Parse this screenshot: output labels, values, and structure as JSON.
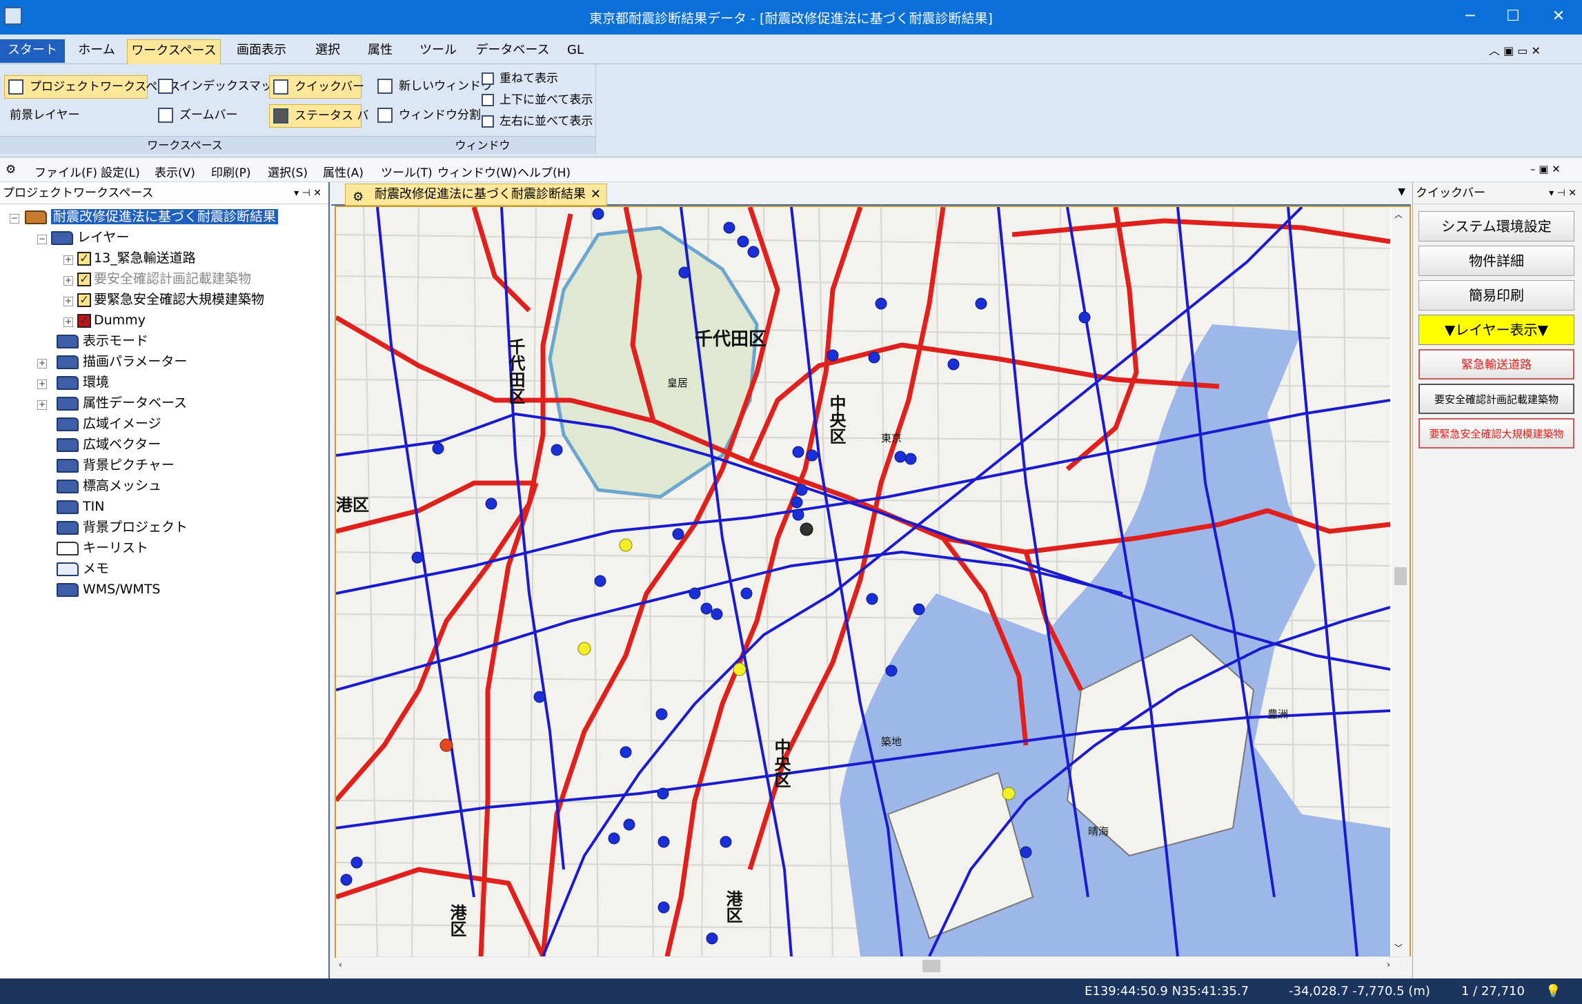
{
  "title": "東京都耐震診断結果データ - [耐震改修促進法に基づく耐震診断結果]",
  "ribbon_tabs": [
    "スタート",
    "ホーム",
    "ワークスペース",
    "画面表示",
    "選択",
    "属性",
    "ツール",
    "データベース",
    "GL"
  ],
  "ribbon": {
    "workspace": {
      "project_ws": "プロジェクトワークスペース",
      "foreground_layer": "前景レイヤー",
      "index_map": "インデックスマップ",
      "zoom_bar": "ズームバー",
      "quick_bar": "クイックバー",
      "status_bar": "ステータス バー",
      "group_label": "ワークスペース"
    },
    "window": {
      "new_window": "新しいウィンドウ",
      "split": "ウィンドウ分割",
      "cascade": "重ねて表示",
      "tile_horizontal": "上下に並べて表示",
      "tile_vertical": "左右に並べて表示",
      "group_label": "ウィンドウ"
    }
  },
  "menu": [
    "ファイル(F)",
    "設定(L)",
    "表示(V)",
    "印刷(P)",
    "選択(S)",
    "属性(A)",
    "ツール(T)",
    "ウィンドウ(W)",
    "ヘルプ(H)"
  ],
  "left_pane": {
    "header": "プロジェクトワークスペース",
    "root": "耐震改修促進法に基づく耐震診断結果",
    "layer": "レイヤー",
    "layers": [
      "13_緊急輸送道路",
      "要安全確認計画記載建築物",
      "要緊急安全確認大規模建築物",
      "Dummy"
    ],
    "folders": [
      "表示モード",
      "描画パラメーター",
      "環境",
      "属性データベース",
      "広域イメージ",
      "広域ベクター",
      "背景ピクチャー",
      "標高メッシュ",
      "TIN",
      "背景プロジェクト",
      "キーリスト",
      "メモ",
      "WMS/WMTS"
    ]
  },
  "map_tab": "耐震改修促進法に基づく耐震診断結果",
  "map_labels": {
    "chiyoda": "千代田区",
    "chiyoda_v": "千代田区",
    "chuo1": "中央区",
    "chuo2": "中央区",
    "minato1": "港区",
    "minato2": "港区",
    "minato3": "港区",
    "kokyo": "皇居",
    "tokyo": "東京",
    "tsukiji": "築地",
    "harumi": "晴海",
    "toyosu": "豊洲"
  },
  "quick_pane": {
    "header": "クイックバー",
    "buttons": [
      "システム環境設定",
      "物件詳細",
      "簡易印刷",
      "▼レイヤー表示▼",
      "緊急輸送道路",
      "要安全確認計画記載建築物",
      "要緊急安全確認大規模建築物"
    ]
  },
  "status": {
    "latlon": "E139:44:50.9 N35:41:35.7",
    "xy": "-34,028.7 -7,770.5 (m)",
    "scale": "1 / 27,710"
  },
  "colors": {
    "accent": "#0a6fd6",
    "road_red": "#e0201c",
    "road_blue": "#1a1ad0",
    "quick_yellow": "#ffff00"
  }
}
